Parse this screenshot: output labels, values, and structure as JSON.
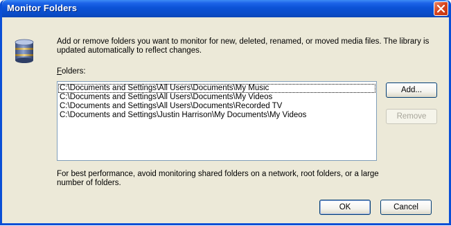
{
  "window": {
    "title": "Monitor Folders"
  },
  "description": "Add or remove folders you want to monitor for new, deleted, renamed, or moved media files. The library is updated automatically to reflect changes.",
  "folders_label": {
    "accel": "F",
    "rest": "olders:"
  },
  "folders": [
    "C:\\Documents and Settings\\All Users\\Documents\\My Music",
    "C:\\Documents and Settings\\All Users\\Documents\\My Videos",
    "C:\\Documents and Settings\\All Users\\Documents\\Recorded TV",
    "C:\\Documents and Settings\\Justin Harrison\\My Documents\\My Videos"
  ],
  "buttons": {
    "add": "Add...",
    "remove": "Remove",
    "ok": "OK",
    "cancel": "Cancel"
  },
  "note": "For best performance, avoid monitoring shared folders on a network, root folders, or a large number of folders.",
  "icons": {
    "close": "close-icon",
    "library": "database-icon"
  },
  "colors": {
    "titlebar": "#0a4fd6",
    "close_button": "#d8461f",
    "dialog_background": "#ece9d8",
    "disabled_text": "#a7a59a"
  }
}
